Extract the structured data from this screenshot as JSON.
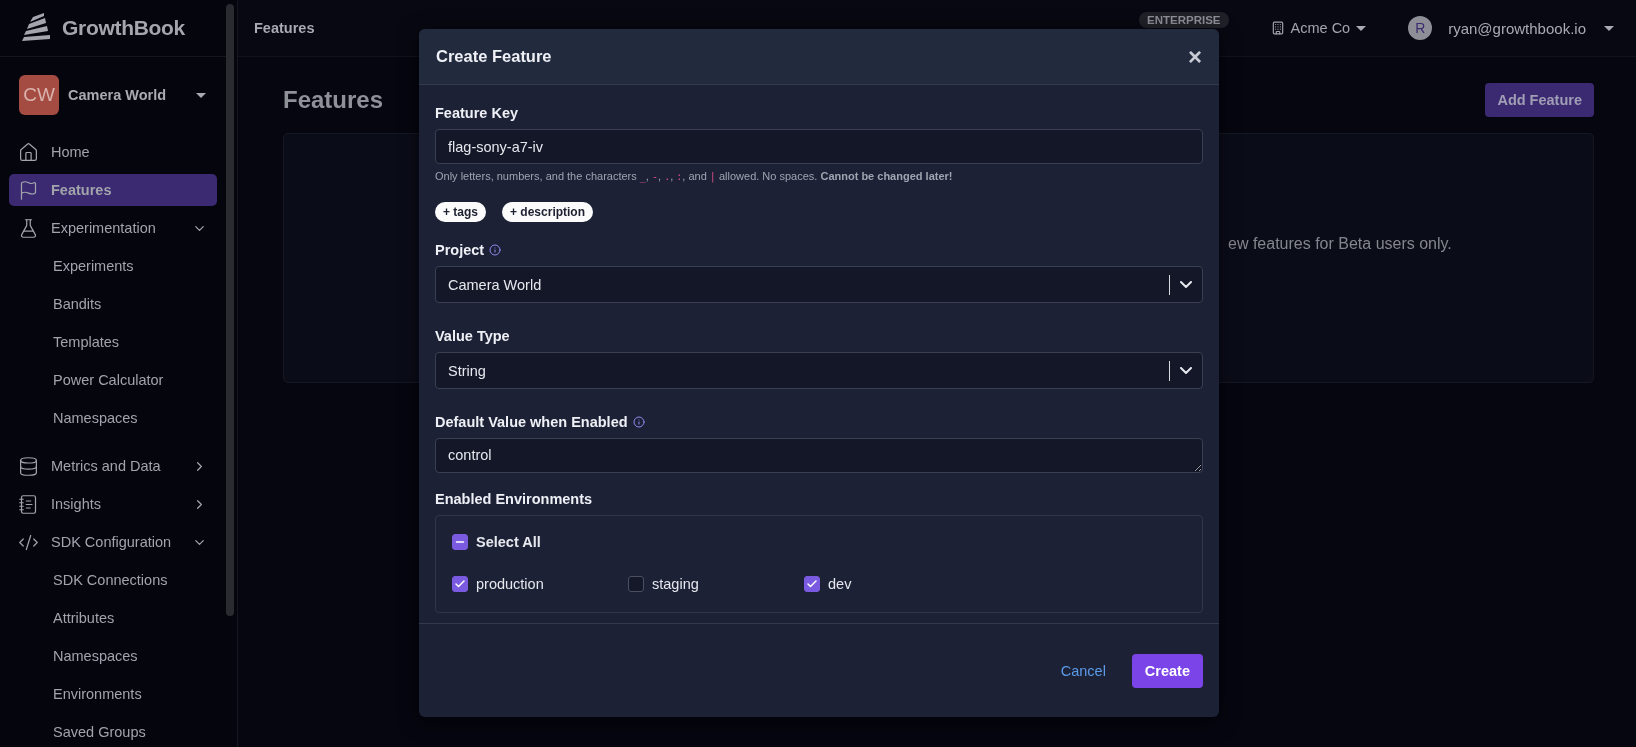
{
  "sidebar": {
    "logo": "GrowthBook",
    "project": {
      "initials": "CW",
      "name": "Camera World"
    },
    "items": [
      {
        "label": "Home",
        "selected": false
      },
      {
        "label": "Features",
        "selected": true
      },
      {
        "label": "Experimentation",
        "selected": false,
        "expanded": true,
        "children": [
          {
            "label": "Experiments",
            "selected": false
          },
          {
            "label": "Bandits",
            "selected": false
          },
          {
            "label": "Templates",
            "selected": false
          },
          {
            "label": "Power Calculator",
            "selected": false
          },
          {
            "label": "Namespaces",
            "selected": false
          }
        ]
      },
      {
        "label": "Metrics and Data",
        "selected": false,
        "expanded": false
      },
      {
        "label": "Insights",
        "selected": false,
        "expanded": false
      },
      {
        "label": "SDK Configuration",
        "selected": false,
        "expanded": true,
        "children": [
          {
            "label": "SDK Connections",
            "selected": false
          },
          {
            "label": "Attributes",
            "selected": false
          },
          {
            "label": "Namespaces",
            "selected": false
          },
          {
            "label": "Environments",
            "selected": false
          },
          {
            "label": "Saved Groups",
            "selected": false
          }
        ]
      }
    ]
  },
  "topbar": {
    "breadcrumb": "Features",
    "plan_badge": "ENTERPRISE",
    "organization": "Acme Co",
    "user": {
      "initial": "R",
      "email": "ryan@growthbook.io"
    }
  },
  "page": {
    "title": "Features",
    "add_button": "Add Feature",
    "card_text": "ew features for Beta users only."
  },
  "modal": {
    "title": "Create Feature",
    "close": "×",
    "feature_key": {
      "label": "Feature Key",
      "value": "flag-sony-a7-iv",
      "hint": [
        {
          "kind": "text",
          "text": "Only letters, numbers, and the characters "
        },
        {
          "kind": "code",
          "text": "_"
        },
        {
          "kind": "text",
          "text": ", "
        },
        {
          "kind": "code",
          "text": "-"
        },
        {
          "kind": "text",
          "text": ", "
        },
        {
          "kind": "code",
          "text": "."
        },
        {
          "kind": "text",
          "text": ", "
        },
        {
          "kind": "code",
          "text": ":"
        },
        {
          "kind": "text",
          "text": ", and "
        },
        {
          "kind": "code",
          "text": "|"
        },
        {
          "kind": "text",
          "text": " allowed. No spaces. "
        },
        {
          "kind": "bold",
          "text": "Cannot be changed later!"
        }
      ]
    },
    "pills": [
      "+ tags",
      "+ description"
    ],
    "project": {
      "label": "Project",
      "info": true,
      "value": "Camera World"
    },
    "value_type": {
      "label": "Value Type",
      "value": "String"
    },
    "default_value": {
      "label": "Default Value when Enabled",
      "info": true,
      "value": "control"
    },
    "environments": {
      "label": "Enabled Environments",
      "select_all": {
        "label": "Select All",
        "indeterminate": true
      },
      "items": [
        {
          "label": "production",
          "checked": true
        },
        {
          "label": "staging",
          "checked": false
        },
        {
          "label": "dev",
          "checked": true
        }
      ]
    },
    "cancel": "Cancel",
    "create": "Create"
  }
}
